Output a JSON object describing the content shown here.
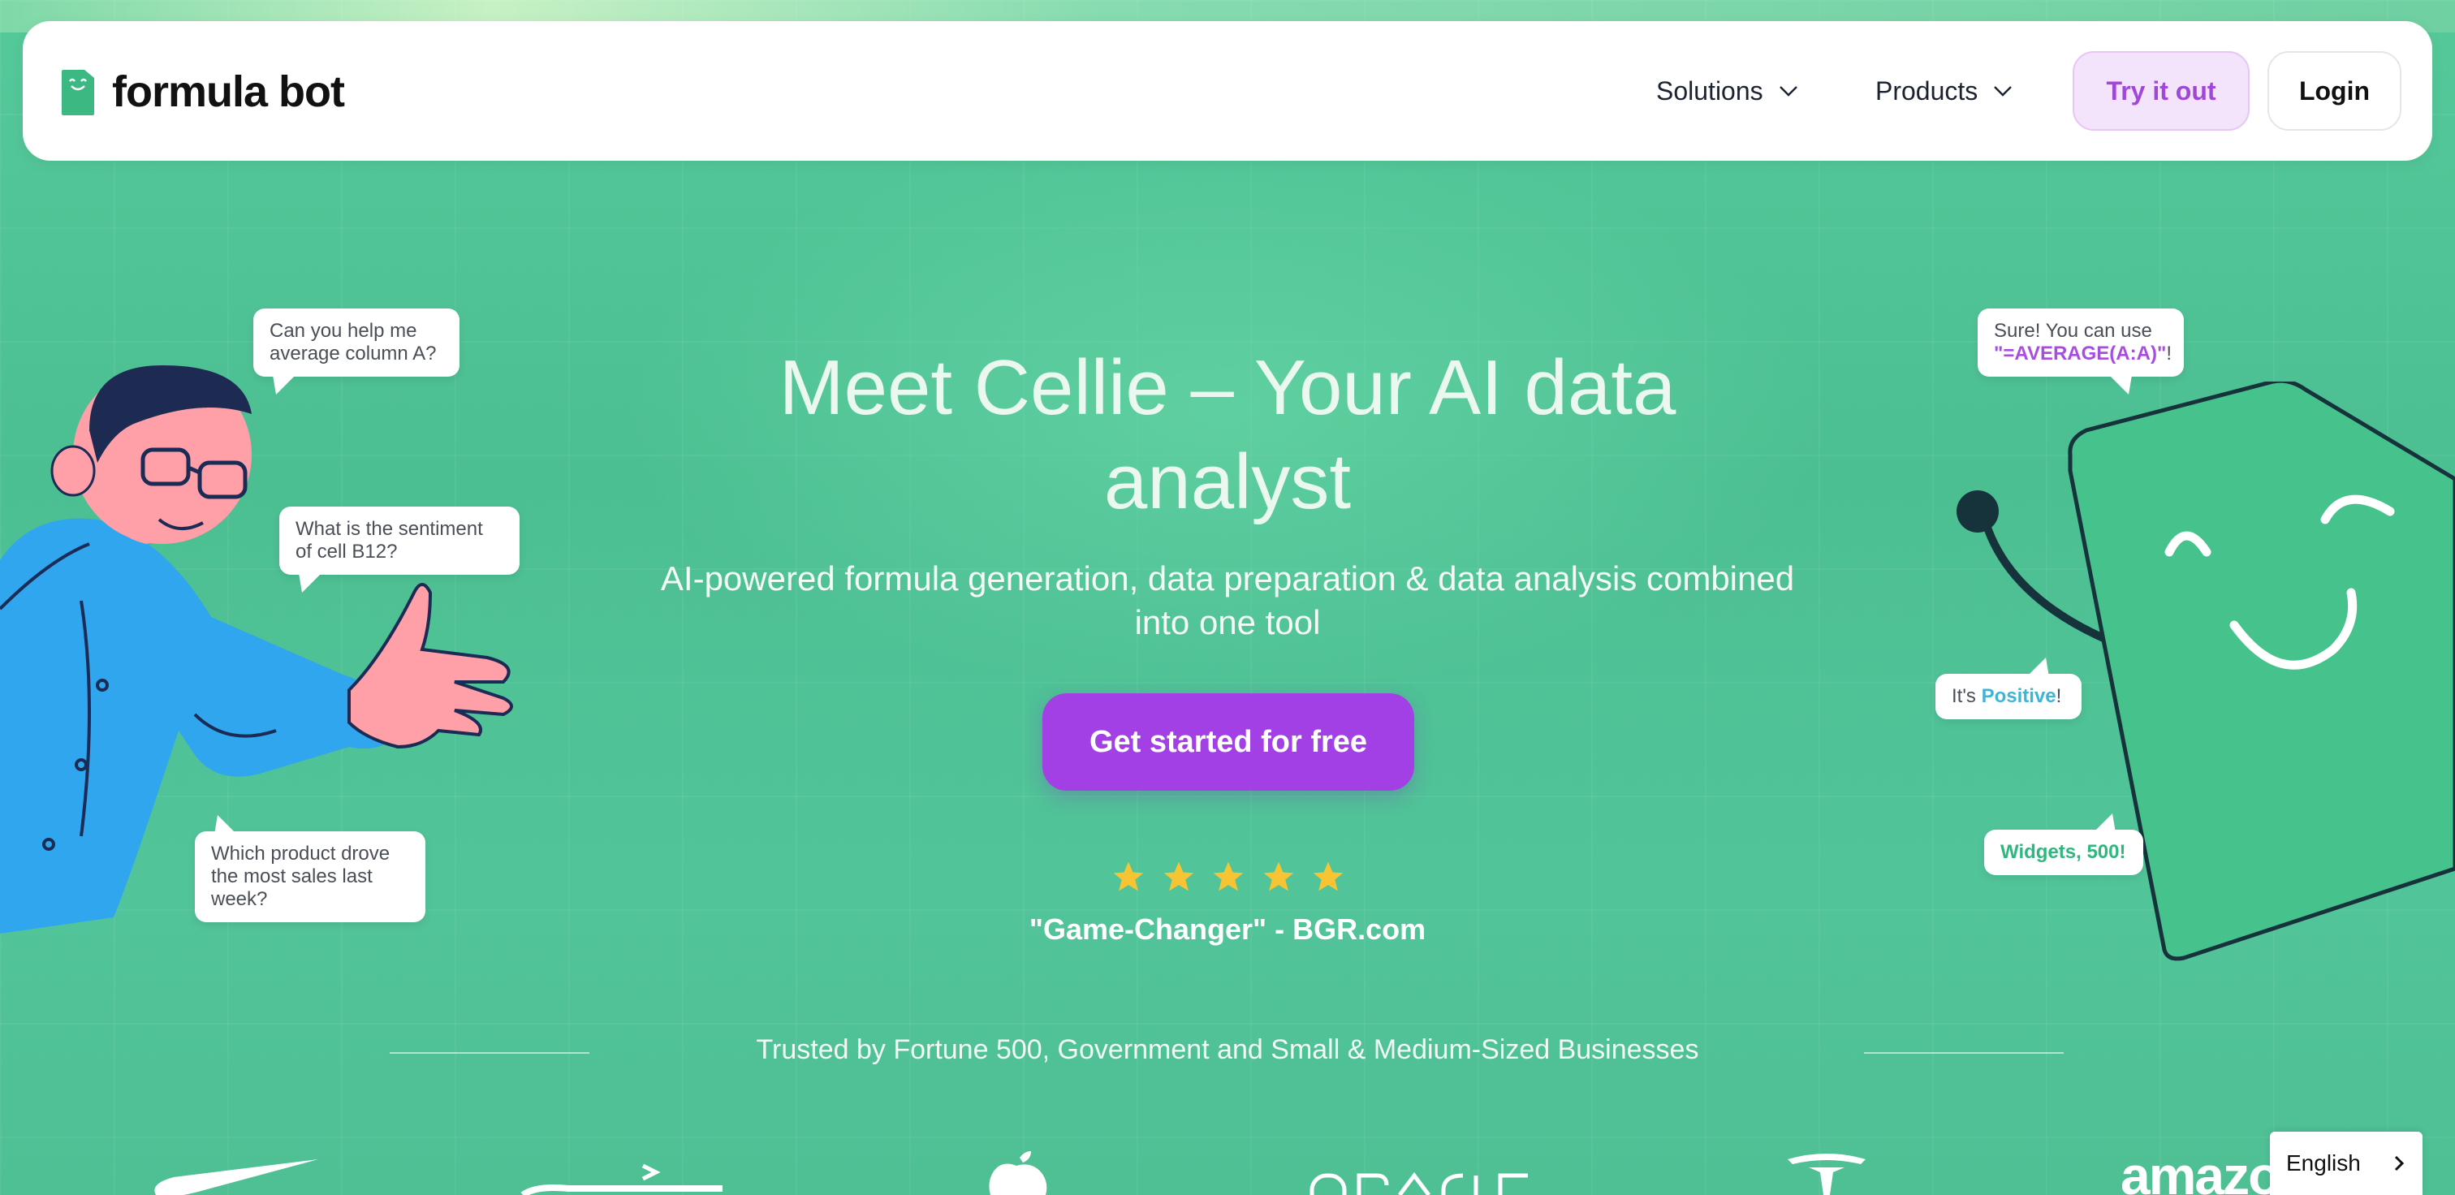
{
  "nav": {
    "brand": "formula bot",
    "solutions_label": "Solutions",
    "products_label": "Products",
    "try_label": "Try it out",
    "login_label": "Login"
  },
  "hero": {
    "title": "Meet Cellie – Your AI data analyst",
    "subtitle": "AI-powered formula generation, data preparation & data analysis combined into one tool",
    "cta_label": "Get started for free",
    "rating_stars": 5,
    "quote": "\"Game-Changer\" - BGR.com",
    "trusted_text": "Trusted by Fortune 500, Government and Small & Medium-Sized Businesses"
  },
  "bubbles": {
    "left_1": "Can you help me average column A?",
    "left_2": "What is the sentiment of cell B12?",
    "left_3": "Which product drove the most sales last week?",
    "right_1_prefix": "Sure! You can use",
    "right_1_formula": "\"=AVERAGE(A:A)\"",
    "right_1_suffix": "!",
    "right_2_prefix": "It's ",
    "right_2_value": "Positive",
    "right_2_suffix": "!",
    "right_3": "Widgets, 500!"
  },
  "logos": [
    "nike",
    "accenture",
    "apple",
    "ORACLE",
    "tesla",
    "amazon"
  ],
  "language": {
    "selected": "English"
  },
  "colors": {
    "background": "#4fc294",
    "cta": "#a240e6",
    "try_bg": "#f3e3fb",
    "try_text": "#a047d9",
    "brand_green": "#3cb983",
    "star": "#f7c533"
  }
}
